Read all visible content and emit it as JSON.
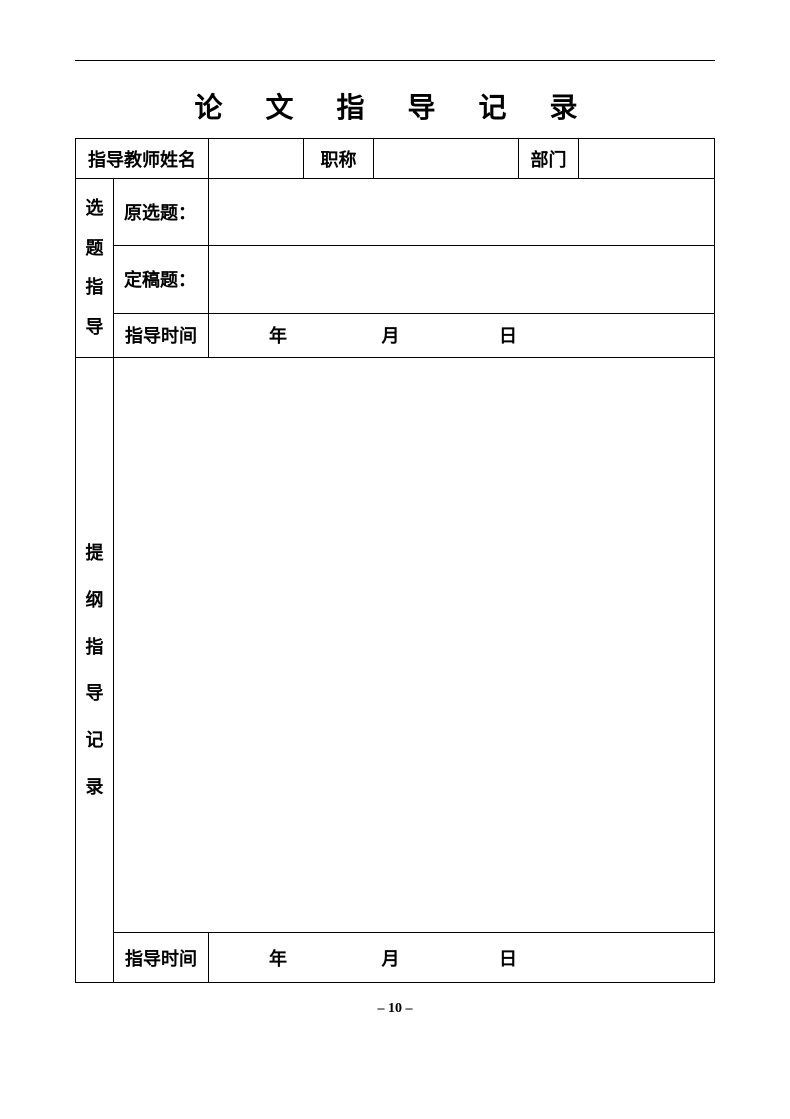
{
  "title": "论 文 指 导 记 录",
  "row1": {
    "teacherNameLabel": "指导教师姓名",
    "titleLabel": "职称",
    "departmentLabel": "部门"
  },
  "topicGuidance": {
    "sectionLabel": "选 题 指 导",
    "originalTopicLabel": "原选题：",
    "finalTopicLabel": "定稿题：",
    "timeLabel": "指导时间",
    "year": "年",
    "month": "月",
    "day": "日"
  },
  "outlineGuidance": {
    "sectionLabel": "提 纲 指 导 记 录",
    "timeLabel": "指导时间",
    "year": "年",
    "month": "月",
    "day": "日"
  },
  "pageNumber": "– 10 –"
}
